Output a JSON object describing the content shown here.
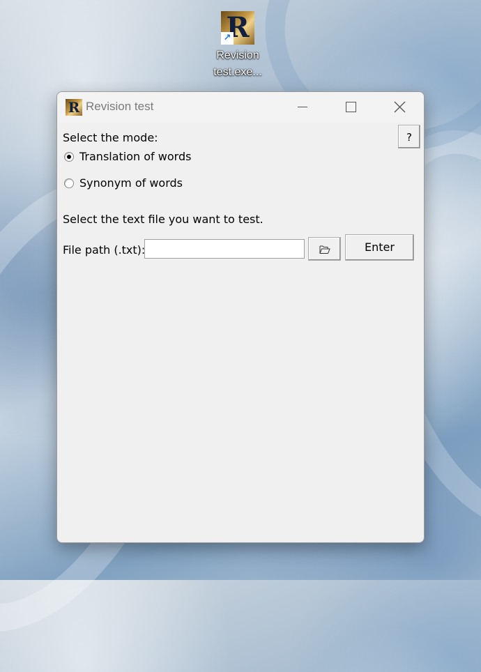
{
  "desktop": {
    "shortcut": {
      "icon": "R-app-icon",
      "line1": "Revision",
      "line2": "test.exe..."
    }
  },
  "window": {
    "title": "Revision test",
    "icon": "R-app-icon",
    "controls": {
      "minimize": "minimize-icon",
      "maximize": "maximize-icon",
      "close": "close-icon"
    }
  },
  "form": {
    "mode_label": "Select the mode:",
    "help_label": "?",
    "modes": [
      {
        "label": "Translation of words",
        "selected": true
      },
      {
        "label": "Synonym of words",
        "selected": false
      }
    ],
    "file_hint": "Select the text file you want to test.",
    "path_label": "File path (.txt):",
    "path_value": "",
    "browse_icon": "folder-open-icon",
    "enter_label": "Enter"
  }
}
